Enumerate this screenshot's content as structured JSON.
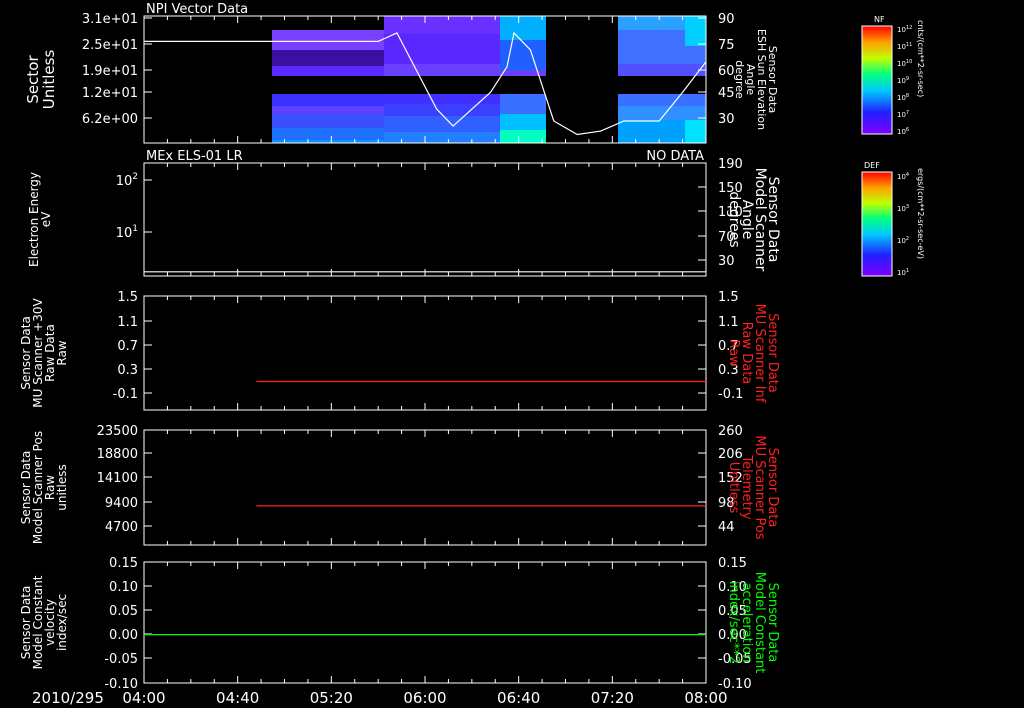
{
  "date_label": "2010/295",
  "time_ticks": [
    "04:00",
    "04:40",
    "05:20",
    "06:00",
    "06:40",
    "07:20",
    "08:00"
  ],
  "chart_data": [
    {
      "type": "heatmap",
      "title": "NPI Vector Data",
      "ylabel": "Sector\nUnitless",
      "yticks": [
        "3.1e+01",
        "2.5e+01",
        "1.9e+01",
        "1.2e+01",
        "6.2e+00"
      ],
      "y2label": "Sensor Data\nESH Sun Elevation\nAngle\ndegree",
      "y2ticks": [
        "90",
        "75",
        "60",
        "45",
        "30"
      ],
      "data_start": "04:50",
      "gap": [
        "06:45",
        "07:15"
      ],
      "overlay_line": {
        "name": "ESH Sun Elevation Angle",
        "x": [
          "04:00",
          "05:40",
          "05:48",
          "06:05",
          "06:12",
          "06:28",
          "06:35",
          "06:38",
          "06:45",
          "06:55",
          "07:05",
          "07:15",
          "07:25",
          "07:40",
          "07:50",
          "08:00"
        ],
        "y": [
          75,
          75,
          80,
          35,
          25,
          45,
          60,
          80,
          70,
          28,
          20,
          22,
          28,
          28,
          45,
          63
        ]
      },
      "colorbar": {
        "label": "NF",
        "ticks": [
          "10^12",
          "10^11",
          "10^10",
          "10^9",
          "10^8",
          "10^7",
          "10^6"
        ],
        "unit": "cnts/(cm**2-sr-sec)"
      }
    },
    {
      "type": "heatmap",
      "title": "MEx ELS-01 LR",
      "status": "NO DATA",
      "ylabel": "Electron Energy\neV",
      "yticks": [
        "10^2",
        "10^1"
      ],
      "y2label": "Sensor Data\nModel Scanner\nAngle\ndegrees",
      "y2ticks": [
        "190",
        "150",
        "110",
        "70",
        "30"
      ],
      "overlay_line": {
        "name": "Model Scanner Angle",
        "x": [
          "04:00",
          "08:00"
        ],
        "y": [
          7,
          7
        ]
      },
      "colorbar": {
        "label": "DEF",
        "ticks": [
          "10^4",
          "10^3",
          "10^2",
          "10^1"
        ],
        "unit": "ergs/(cm**2-sr-sec-eV)"
      }
    },
    {
      "type": "line",
      "ylabel": "Sensor Data\nMU Scanner +30V\nRaw Data\nRaw",
      "yticks": [
        "1.5",
        "1.1",
        "0.7",
        "0.3",
        "-0.1"
      ],
      "y2label": "Sensor Data\nMU Scanner Inf\nRaw Data\nRaw",
      "y2ticks": [
        "1.5",
        "1.1",
        "0.7",
        "0.3",
        "-0.1"
      ],
      "ylim": [
        -0.5,
        1.5
      ],
      "series": [
        {
          "name": "MU Scanner Inf Raw Data",
          "x": [
            "04:48",
            "08:00"
          ],
          "values": [
            0,
            0
          ],
          "color": "#ff2020"
        }
      ]
    },
    {
      "type": "line",
      "ylabel": "Sensor Data\nModel Scanner Pos\nRaw\nunitless",
      "yticks": [
        "23500",
        "18800",
        "14100",
        "9400",
        "4700"
      ],
      "y2label": "Sensor Data\nMU Scanner Pos\nTelemetry\nUnitless",
      "y2ticks": [
        "260",
        "206",
        "152",
        "98",
        "44"
      ],
      "ylim": [
        0,
        23500
      ],
      "series": [
        {
          "name": "MU Scanner Pos Telemetry",
          "x": [
            "04:48",
            "08:00"
          ],
          "values": [
            8000,
            8000
          ],
          "color": "#ff2020"
        }
      ]
    },
    {
      "type": "line",
      "ylabel": "Sensor Data\nModel Constant\nvelocity\nindex/sec",
      "yticks": [
        "0.15",
        "0.10",
        "0.05",
        "0.00",
        "-0.05",
        "-0.10"
      ],
      "y2label": "Sensor Data\nModel Constant\nacceleration\nindex/sec**2",
      "y2ticks": [
        "0.15",
        "0.10",
        "0.05",
        "0.00",
        "-0.05",
        "-0.10"
      ],
      "ylim": [
        -0.1,
        0.15
      ],
      "series": [
        {
          "name": "Model Constant acceleration",
          "x": [
            "04:00",
            "08:00"
          ],
          "values": [
            0,
            0
          ],
          "color": "#00ff00"
        }
      ]
    }
  ],
  "colors": {
    "axis": "#ffffff",
    "red": "#ff2020",
    "green": "#00ff00"
  }
}
